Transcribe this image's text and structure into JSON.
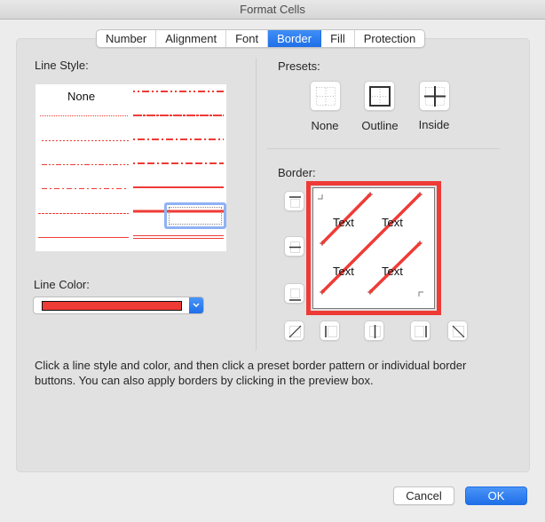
{
  "window": {
    "title": "Format Cells"
  },
  "tabs": [
    {
      "label": "Number",
      "active": false
    },
    {
      "label": "Alignment",
      "active": false
    },
    {
      "label": "Font",
      "active": false
    },
    {
      "label": "Border",
      "active": true
    },
    {
      "label": "Fill",
      "active": false
    },
    {
      "label": "Protection",
      "active": false
    }
  ],
  "line_style": {
    "label": "Line Style:",
    "none_label": "None",
    "styles": [
      {
        "id": "none",
        "column": "left"
      },
      {
        "id": "hair",
        "column": "left"
      },
      {
        "id": "dotted",
        "column": "left"
      },
      {
        "id": "dash-dot-dot",
        "column": "left"
      },
      {
        "id": "dash-dot",
        "column": "left"
      },
      {
        "id": "dashed",
        "column": "left"
      },
      {
        "id": "thin",
        "column": "left"
      },
      {
        "id": "medium-dash-dot-dot",
        "column": "right"
      },
      {
        "id": "slanted-dash-dot",
        "column": "right"
      },
      {
        "id": "medium-dash-dot",
        "column": "right"
      },
      {
        "id": "medium-dashed",
        "column": "right"
      },
      {
        "id": "medium",
        "column": "right"
      },
      {
        "id": "thick",
        "column": "right",
        "selected": true
      },
      {
        "id": "double",
        "column": "right"
      }
    ],
    "selected": "thick"
  },
  "line_color": {
    "label": "Line Color:",
    "value": "#ef3b36"
  },
  "presets": {
    "label": "Presets:",
    "items": [
      {
        "label": "None",
        "icon": "preset-none-icon"
      },
      {
        "label": "Outline",
        "icon": "preset-outline-icon"
      },
      {
        "label": "Inside",
        "icon": "preset-inside-icon"
      }
    ]
  },
  "border": {
    "label": "Border:",
    "preview_text": [
      "Text",
      "Text",
      "Text",
      "Text"
    ],
    "buttons": [
      {
        "name": "border-top",
        "icon": "border-top-icon"
      },
      {
        "name": "border-inside-horizontal",
        "icon": "border-inside-horizontal-icon"
      },
      {
        "name": "border-bottom",
        "icon": "border-bottom-icon"
      },
      {
        "name": "border-diagonal-up",
        "icon": "diagonal-up-icon"
      },
      {
        "name": "border-left",
        "icon": "border-left-icon"
      },
      {
        "name": "border-inside-vertical",
        "icon": "border-inside-vertical-icon"
      },
      {
        "name": "border-right",
        "icon": "border-right-icon"
      },
      {
        "name": "border-diagonal-down",
        "icon": "diagonal-down-icon"
      }
    ],
    "applied": [
      "diagonal-up",
      "outline-selection-thick"
    ],
    "accent": "#ef3b36"
  },
  "help_text": "Click a line style and color, and then click a preset border pattern or individual border buttons. You can also apply borders by clicking in the preview box.",
  "footer": {
    "cancel_label": "Cancel",
    "ok_label": "OK"
  },
  "colors": {
    "accent_blue": "#1f6fe8",
    "line_red": "#ef3b36",
    "selection_blue": "#8fb2f3"
  }
}
